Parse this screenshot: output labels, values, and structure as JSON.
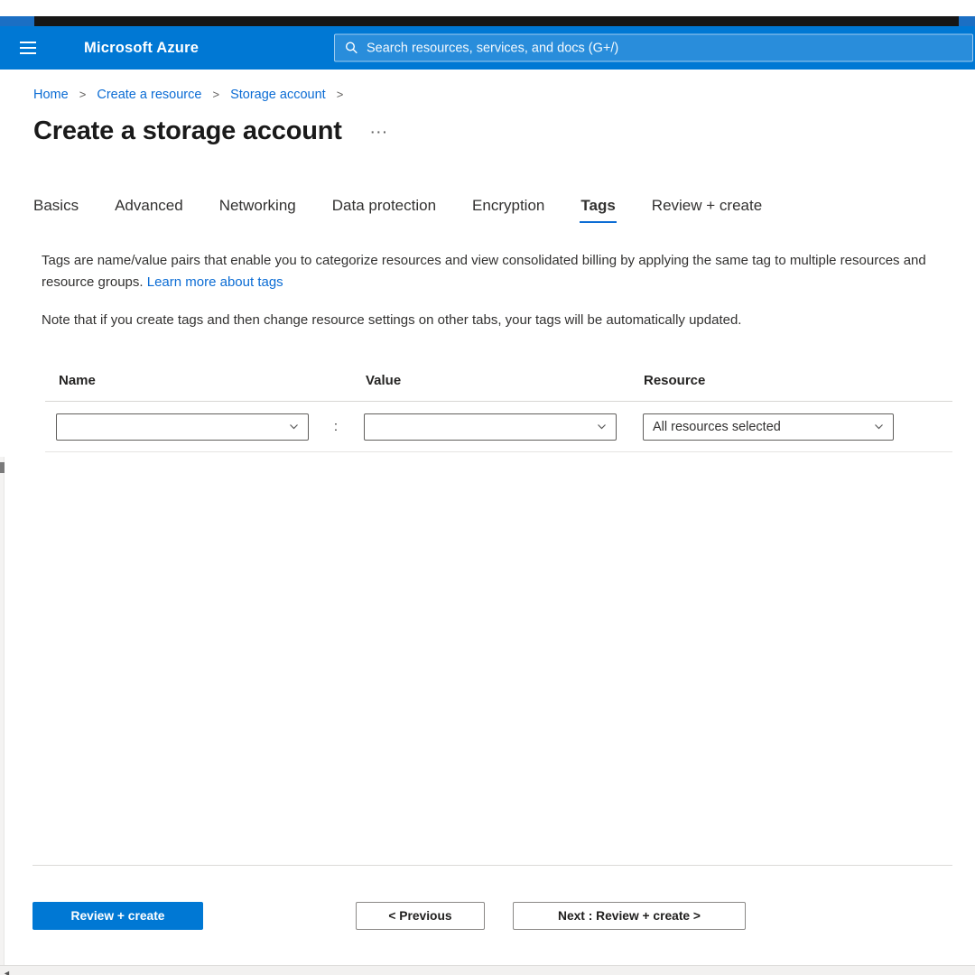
{
  "header": {
    "brand": "Microsoft Azure",
    "search_placeholder": "Search resources, services, and docs (G+/)"
  },
  "breadcrumb": {
    "items": [
      "Home",
      "Create a resource",
      "Storage account"
    ],
    "separator": ">"
  },
  "page": {
    "title": "Create a storage account",
    "overflow_menu": "···"
  },
  "tabs": [
    "Basics",
    "Advanced",
    "Networking",
    "Data protection",
    "Encryption",
    "Tags",
    "Review + create"
  ],
  "active_tab": "Tags",
  "content": {
    "description": "Tags are name/value pairs that enable you to categorize resources and view consolidated billing by applying the same tag to multiple resources and resource groups.",
    "learn_more": "Learn more about tags",
    "note": "Note that if you create tags and then change resource settings on other tabs, your tags will be automatically updated."
  },
  "tag_table": {
    "columns": [
      "Name",
      "Value",
      "Resource"
    ],
    "separator": ":",
    "row": {
      "name": "",
      "value": "",
      "resource": "All resources selected"
    }
  },
  "footer": {
    "review_create": "Review + create",
    "previous": "< Previous",
    "next": "Next : Review + create >"
  },
  "icons": {
    "scroll_left": "◄"
  },
  "colors": {
    "azure_blue": "#0078d4",
    "link_blue": "#0b6cd4",
    "text_dark": "#323130",
    "dropdown_border": "#605e5c",
    "divider": "#dcdad8"
  }
}
